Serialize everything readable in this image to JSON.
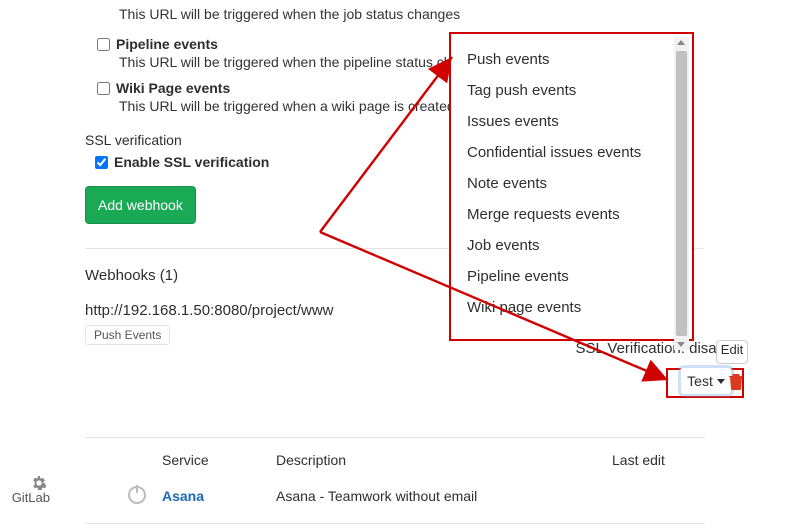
{
  "job_event_desc": "This URL will be triggered when the job status changes",
  "events": [
    {
      "key": "pipeline",
      "label": "Pipeline events",
      "desc": "This URL will be triggered when the pipeline status changes",
      "checked": false
    },
    {
      "key": "wiki",
      "label": "Wiki Page events",
      "desc": "This URL will be triggered when a wiki page is created",
      "checked": false
    }
  ],
  "ssl": {
    "heading": "SSL verification",
    "label": "Enable SSL verification",
    "checked": true
  },
  "add_btn": "Add webhook",
  "webhooks_heading": "Webhooks (1)",
  "hook": {
    "url": "http://192.168.1.50:8080/project/www",
    "pill": "Push Events",
    "ssl_status": "SSL Verification: disabled"
  },
  "buttons": {
    "edit": "Edit",
    "test": "Test"
  },
  "dropdown": {
    "items": [
      "Push events",
      "Tag push events",
      "Issues events",
      "Confidential issues events",
      "Note events",
      "Merge requests events",
      "Job events",
      "Pipeline events",
      "Wiki page events"
    ]
  },
  "table": {
    "headers": {
      "service": "Service",
      "description": "Description",
      "last_edit": "Last edit"
    },
    "rows": [
      {
        "name": "Asana",
        "url": "#",
        "description": "Asana - Teamwork without email",
        "last_edit": ""
      }
    ]
  },
  "left_rail": "GitLab"
}
